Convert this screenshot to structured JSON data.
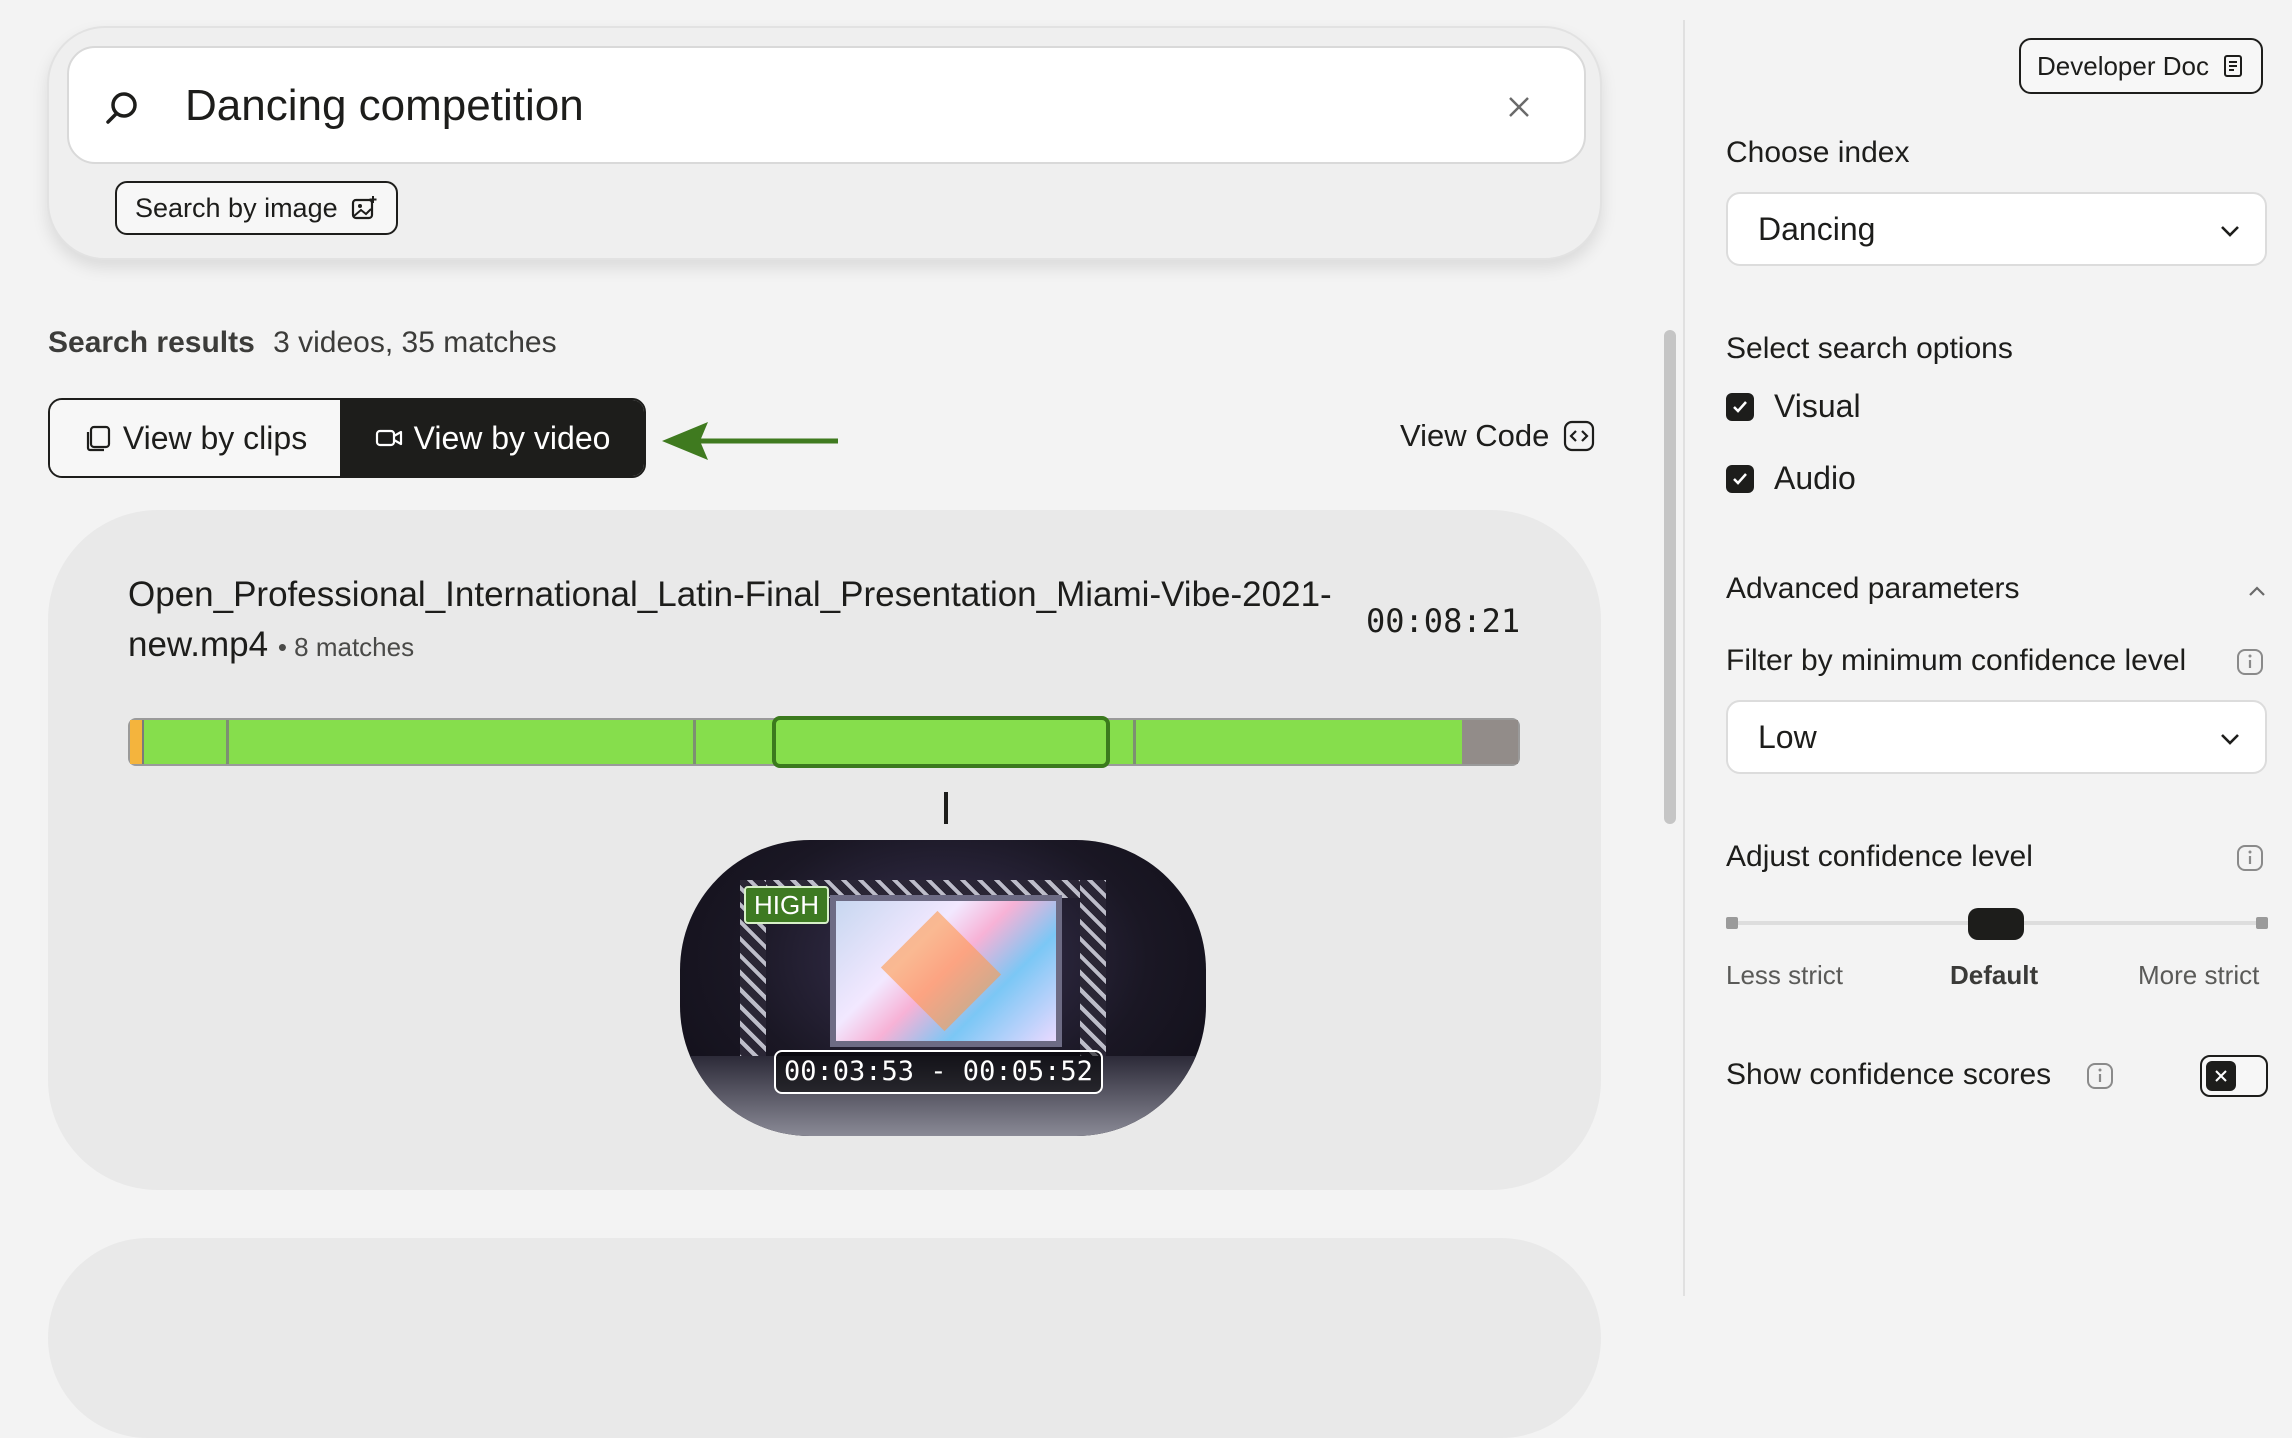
{
  "search": {
    "query": "Dancing competition",
    "image_button_label": "Search by image"
  },
  "results": {
    "heading": "Search results",
    "summary": "3 videos, 35 matches"
  },
  "view_toggle": {
    "clips_label": "View by clips",
    "video_label": "View by video",
    "selected": "video"
  },
  "view_code_label": "View Code",
  "video": {
    "title": "Open_Professional_International_Latin-Final_Presentation_Miami-Vibe-2021-new.mp4",
    "matches": "• 8 matches",
    "duration": "00:08:21",
    "clip_confidence": "HIGH",
    "clip_range": "00:03:53 - 00:05:52"
  },
  "sidebar": {
    "developer_doc_label": "Developer Doc",
    "choose_index_label": "Choose index",
    "index_value": "Dancing",
    "search_options_label": "Select search options",
    "options": [
      {
        "label": "Visual",
        "checked": true
      },
      {
        "label": "Audio",
        "checked": true
      }
    ],
    "advanced_label": "Advanced parameters",
    "filter_label": "Filter by minimum confidence level",
    "filter_value": "Low",
    "adjust_label": "Adjust confidence level",
    "slider_labels": {
      "left": "Less strict",
      "middle": "Default",
      "right": "More strict"
    },
    "slider_value_fraction": 0.5,
    "show_scores_label": "Show confidence scores",
    "show_scores_enabled": false
  },
  "colors": {
    "timeline_match": "#86de4c",
    "high_badge": "#3e7a22",
    "arrow": "#3f7a1f",
    "primary_dark": "#1d1d1b"
  }
}
